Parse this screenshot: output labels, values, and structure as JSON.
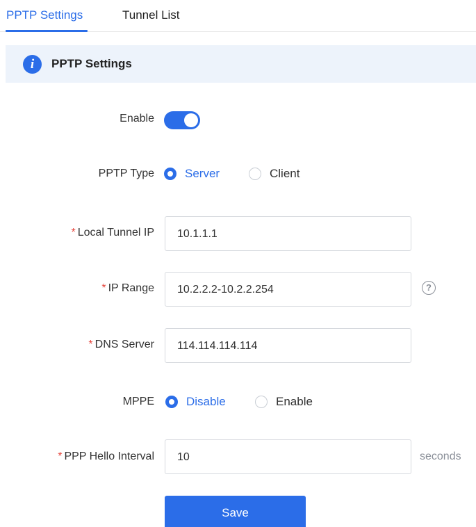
{
  "tabs": [
    {
      "label": "PPTP Settings",
      "active": true
    },
    {
      "label": "Tunnel List",
      "active": false
    }
  ],
  "banner": {
    "title": "PPTP Settings",
    "icon": "info-icon"
  },
  "form": {
    "enable": {
      "label": "Enable",
      "value": true
    },
    "pptp_type": {
      "label": "PPTP Type",
      "options": [
        "Server",
        "Client"
      ],
      "selected": "Server"
    },
    "local_tunnel_ip": {
      "required": "*",
      "label": "Local Tunnel IP",
      "value": "10.1.1.1"
    },
    "ip_range": {
      "required": "*",
      "label": "IP Range",
      "value": "10.2.2.2-10.2.2.254",
      "help_icon": "question-circle-icon",
      "help_glyph": "?"
    },
    "dns_server": {
      "required": "*",
      "label": "DNS Server",
      "value": "114.114.114.114"
    },
    "mppe": {
      "label": "MPPE",
      "options": [
        "Disable",
        "Enable"
      ],
      "selected": "Disable"
    },
    "ppp_hello_interval": {
      "required": "*",
      "label": "PPP Hello Interval",
      "value": "10",
      "suffix": "seconds"
    }
  },
  "actions": {
    "save_label": "Save"
  },
  "colors": {
    "accent": "#2b6de8",
    "banner_bg": "#edf3fb",
    "required": "#e5443b",
    "muted": "#8a8f98"
  }
}
